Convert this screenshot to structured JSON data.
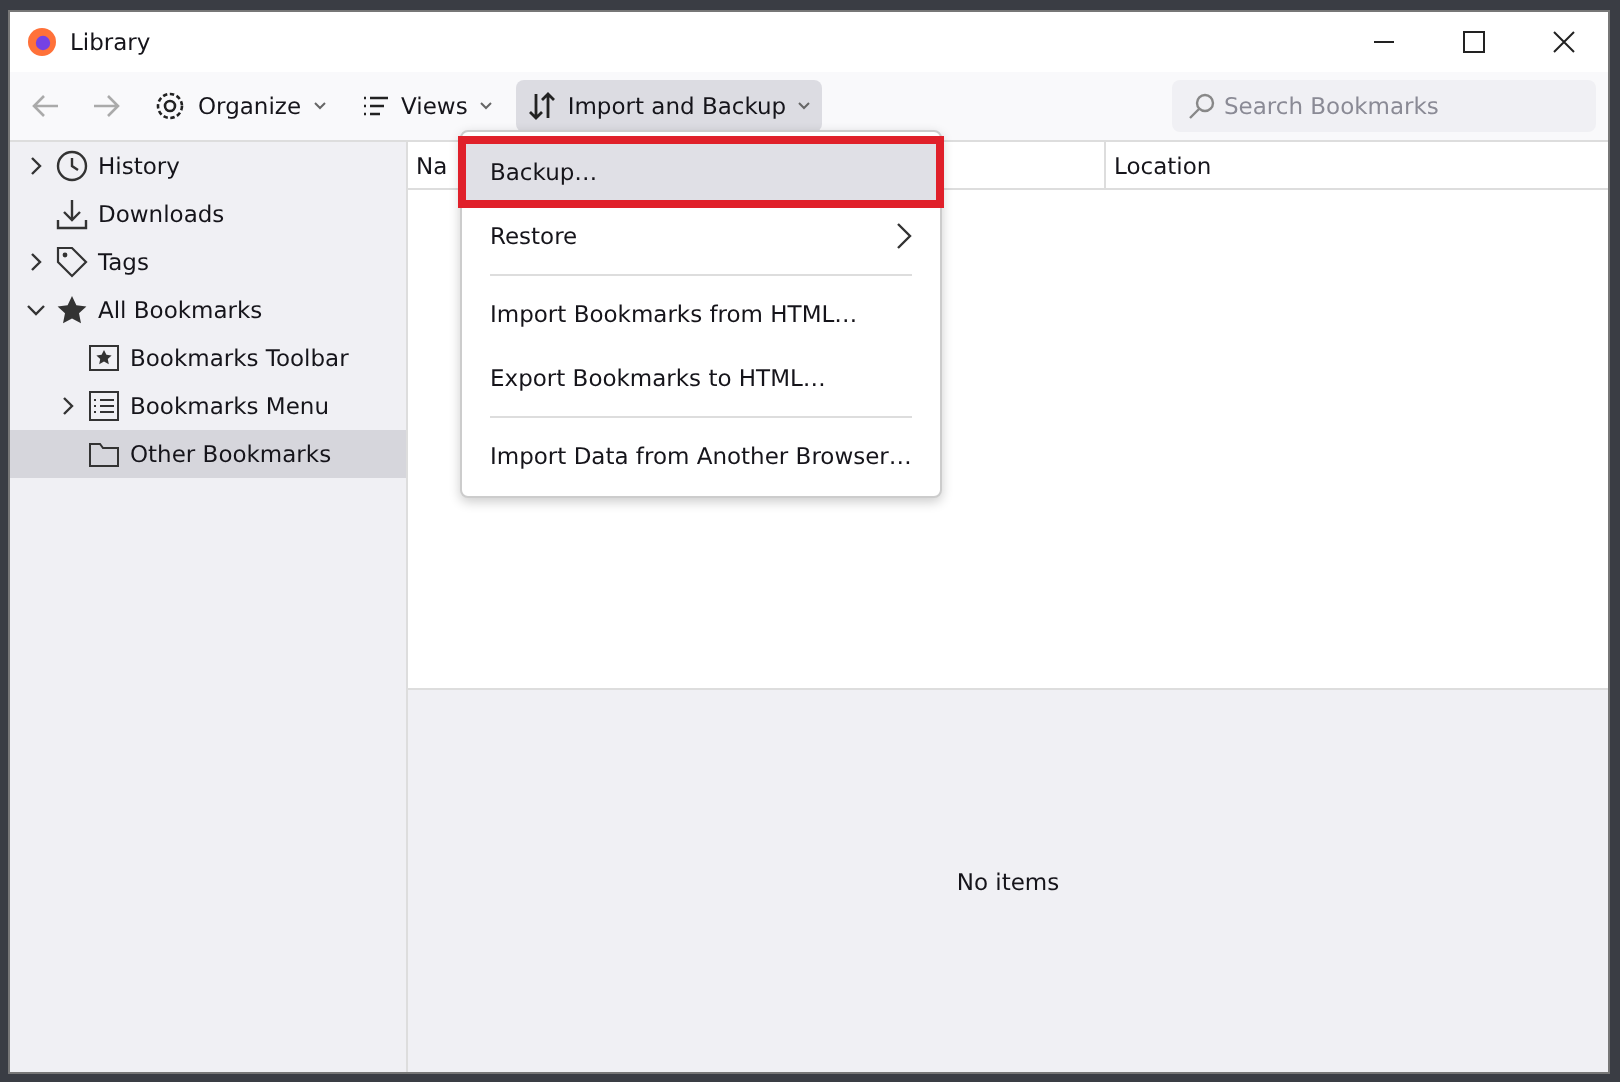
{
  "window": {
    "title": "Library"
  },
  "toolbar": {
    "buttons": [
      {
        "label": "Organize",
        "selected": false
      },
      {
        "label": "Views",
        "selected": false
      },
      {
        "label": "Import and Backup",
        "selected": true
      }
    ],
    "search": {
      "placeholder": "Search Bookmarks"
    }
  },
  "sidebar": {
    "items": [
      {
        "label": "History",
        "expanded": false,
        "selected": false
      },
      {
        "label": "Downloads",
        "selected": false
      },
      {
        "label": "Tags",
        "expanded": false,
        "selected": false
      },
      {
        "label": "All Bookmarks",
        "expanded": true,
        "selected": false,
        "children": [
          {
            "label": "Bookmarks Toolbar",
            "selected": false
          },
          {
            "label": "Bookmarks Menu",
            "expanded": false,
            "selected": false
          },
          {
            "label": "Other Bookmarks",
            "selected": true
          }
        ]
      }
    ]
  },
  "table": {
    "columns": [
      "Na",
      "Location"
    ]
  },
  "details": {
    "message": "No items"
  },
  "menu": {
    "items": [
      {
        "kind": "item",
        "label": "Backup…",
        "selected": true,
        "highlighted": true
      },
      {
        "kind": "submenu",
        "label": "Restore",
        "selected": false,
        "highlighted": false
      },
      {
        "kind": "separator"
      },
      {
        "kind": "item",
        "label": "Import Bookmarks from HTML…",
        "selected": false,
        "highlighted": false
      },
      {
        "kind": "item",
        "label": "Export Bookmarks to HTML…",
        "selected": false,
        "highlighted": false
      },
      {
        "kind": "separator"
      },
      {
        "kind": "item",
        "label": "Import Data from Another Browser…",
        "selected": false,
        "highlighted": false
      }
    ]
  }
}
